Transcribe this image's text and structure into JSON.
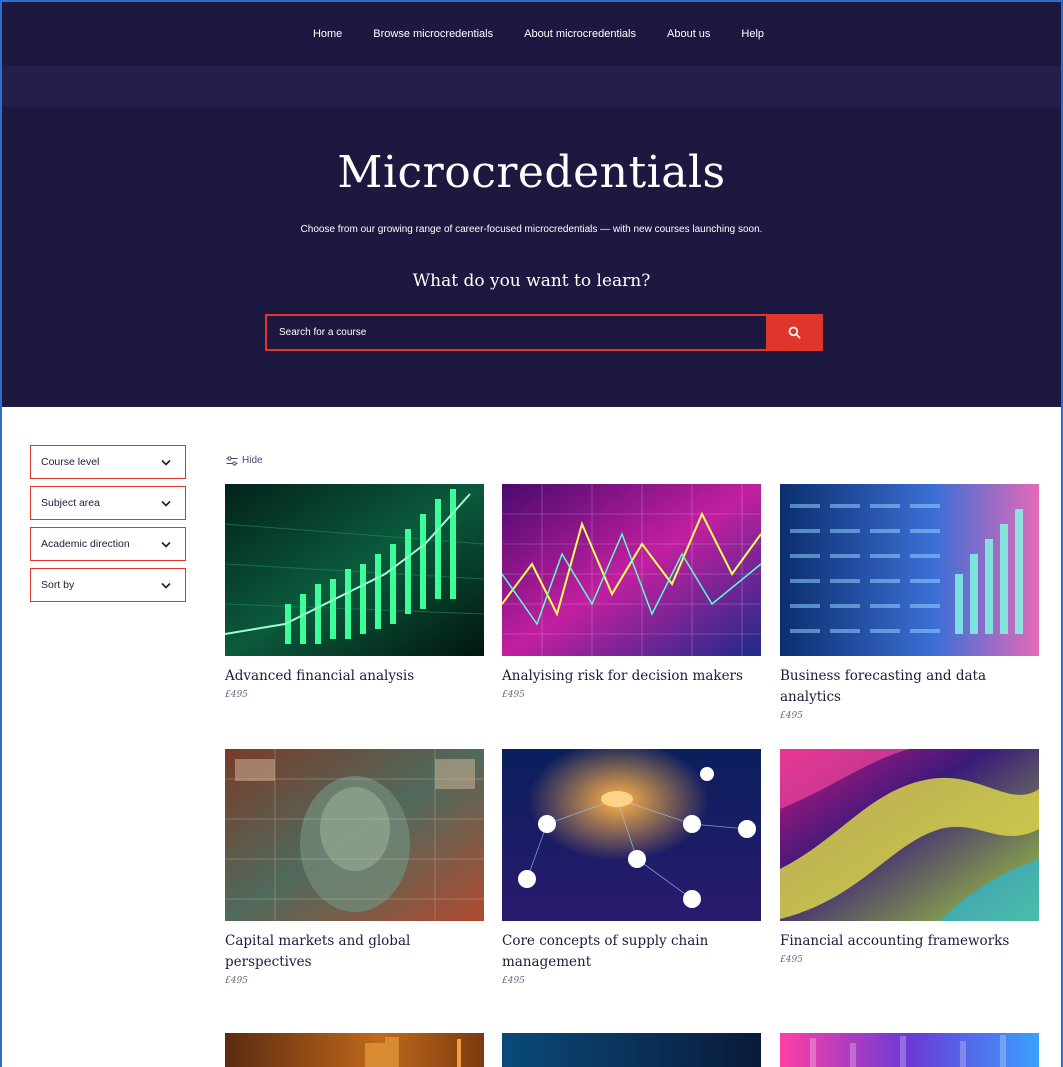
{
  "nav": {
    "items": [
      "Home",
      "Browse microcredentials",
      "About microcredentials",
      "About us",
      "Help"
    ]
  },
  "hero": {
    "title": "Microcredentials",
    "intro": "Choose from our growing range of career-focused microcredentials — with new courses launching soon.",
    "question": "What do you want to learn?"
  },
  "search": {
    "placeholder": "Search for a course",
    "icon": "search-icon"
  },
  "filters": {
    "items": [
      "Course level",
      "Subject area",
      "Academic direction",
      "Sort by"
    ],
    "hide_label": "Hide"
  },
  "courses": [
    {
      "title": "Advanced financial analysis",
      "price": "£495"
    },
    {
      "title": "Analyising risk for decision makers",
      "price": "£495"
    },
    {
      "title": "Business forecasting and data analytics",
      "price": "£495"
    },
    {
      "title": "Capital markets and global perspectives",
      "price": "£495"
    },
    {
      "title": "Core concepts of supply chain management",
      "price": "£495"
    },
    {
      "title": "Financial accounting frameworks",
      "price": "£495"
    }
  ],
  "colors": {
    "navy": "#1c1840",
    "accent_red": "#e0352b"
  }
}
